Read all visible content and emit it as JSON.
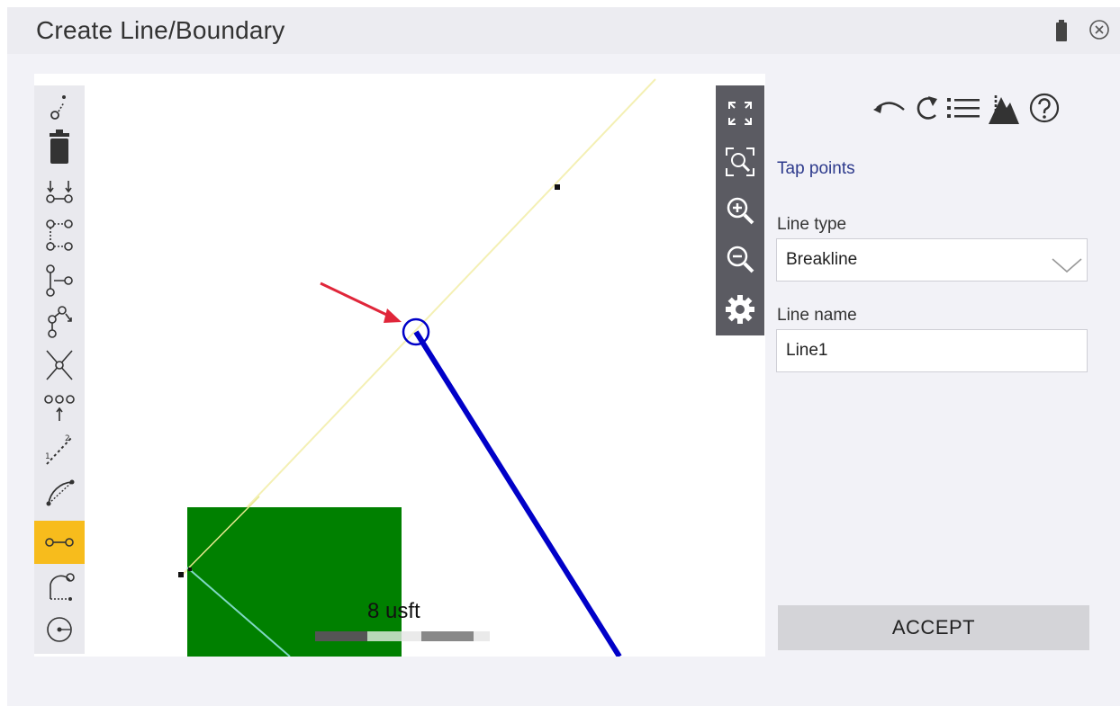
{
  "window": {
    "title": "Create Line/Boundary"
  },
  "panel": {
    "instruction": "Tap points",
    "line_type_label": "Line type",
    "line_type_value": "Breakline",
    "line_name_label": "Line name",
    "line_name_value": "Line1",
    "accept_label": "ACCEPT"
  },
  "map": {
    "scale_label": "8 usft"
  },
  "left_toolbar": {
    "active_tool": "line-from-two-points"
  },
  "colors": {
    "highlight": "#f7bc1c",
    "line": "#0000c8",
    "surface": "#008000",
    "annotation_arrow": "#e0263a"
  }
}
